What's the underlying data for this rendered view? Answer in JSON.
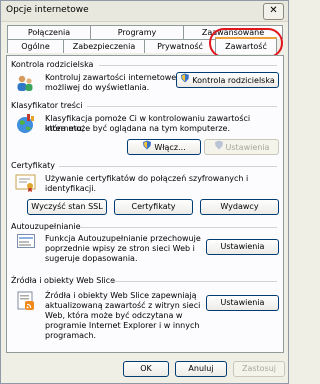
{
  "window": {
    "title": "Opcje internetowe",
    "close_symbol": "✕"
  },
  "tabs": {
    "row1": [
      "Połączenia",
      "Programy",
      "Zaawansowane"
    ],
    "row2": [
      "Ogólne",
      "Zabezpieczenia",
      "Prywatność",
      "Zawartość"
    ],
    "active": "Zawartość"
  },
  "sections": {
    "parental": {
      "title": "Kontrola rodzicielska",
      "desc_line1": "Kontroluj zawartości internetowej",
      "desc_line2": "możliwej do wyświetlania.",
      "button": "Kontrola rodzicielska"
    },
    "ratings": {
      "title": "Klasyfikator treści",
      "desc_line1": "Klasyfikacja pomoże Ci w kontrolowaniu zawartości Internetu,",
      "desc_line2": "która może być oglądana na tym komputerze.",
      "enable_button": "Włącz...",
      "settings_button": "Ustawienia"
    },
    "certificates": {
      "title": "Certyfikaty",
      "desc_line1": "Używanie certyfikatów do połączeń szyfrowanych i",
      "desc_line2": "identyfikacji.",
      "clear_ssl_button": "Wyczyść stan SSL",
      "certs_button": "Certyfikaty",
      "publishers_button": "Wydawcy"
    },
    "autocomplete": {
      "title": "Autouzupełnianie",
      "desc_line1": "Funkcja Autouzupełnianie przechowuje",
      "desc_line2": "poprzednie wpisy ze stron sieci Web i",
      "desc_line3": "sugeruje dopasowania.",
      "button": "Ustawienia"
    },
    "feeds": {
      "title": "Źródła i obiekty Web Slice",
      "desc_line1": "Źródła i obiekty Web Slice zapewniają",
      "desc_line2": "aktualizowaną zawartość z witryn sieci",
      "desc_line3": "Web, która może być odczytana w",
      "desc_line4": "programie Internet Explorer i w innych",
      "desc_line5": "programach.",
      "button": "Ustawienia"
    }
  },
  "footer": {
    "ok": "OK",
    "cancel": "Anuluj",
    "apply": "Zastosuj"
  },
  "colors": {
    "highlight_ring": "#e0161d",
    "active_tab_accent": "#f0a13a"
  }
}
